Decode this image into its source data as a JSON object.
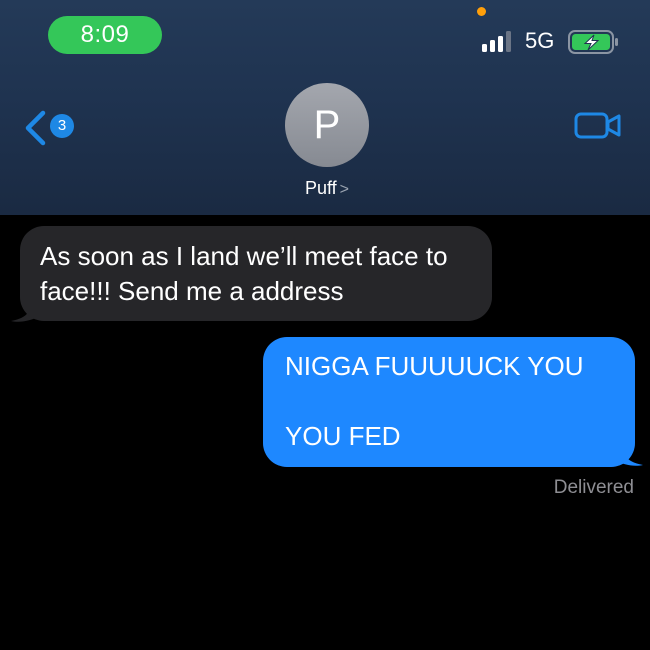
{
  "status_bar": {
    "time": "8:09",
    "network": "5G",
    "colors": {
      "time_pill": "#34c759",
      "indicator_dot": "#ff9f0a",
      "battery_fill": "#34c759"
    }
  },
  "nav": {
    "back_count": "3",
    "contact_initial": "P",
    "contact_name": "Puff",
    "name_chevron": ">",
    "icons": [
      "back-chevron-icon",
      "video-camera-icon"
    ]
  },
  "messages": [
    {
      "direction": "incoming",
      "lines": [
        "As soon as I land we’ll meet face to face!!! Send me a address"
      ]
    },
    {
      "direction": "outgoing",
      "lines": [
        "NIGGA FUUUUUCK YOU",
        "YOU FED"
      ]
    }
  ],
  "receipt": "Delivered",
  "colors": {
    "header_bg": "#1f3350",
    "incoming_bubble": "#262629",
    "outgoing_bubble": "#1e88ff",
    "accent": "#1e88e5"
  }
}
